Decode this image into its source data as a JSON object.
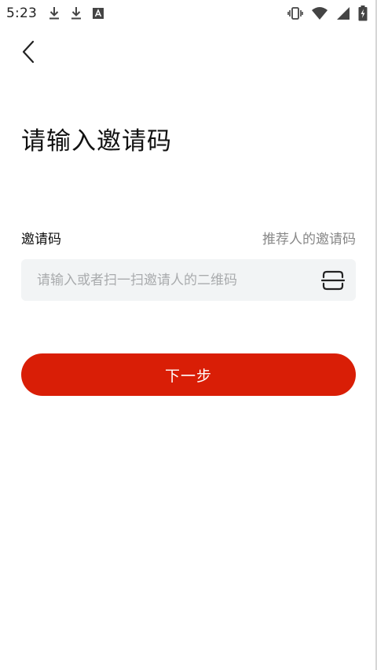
{
  "status_bar": {
    "time": "5:23",
    "icons_left": [
      "download-icon",
      "download-icon",
      "font-icon"
    ],
    "icons_right": [
      "vibrate-icon",
      "wifi-icon",
      "signal-icon",
      "battery-icon"
    ]
  },
  "header": {
    "back_icon": "back-arrow-icon"
  },
  "page": {
    "title": "请输入邀请码"
  },
  "form": {
    "label": "邀请码",
    "hint": "推荐人的邀请码",
    "input_value": "",
    "input_placeholder": "请输入或者扫一扫邀请人的二维码",
    "scan_icon": "scan-icon"
  },
  "actions": {
    "next_label": "下一步"
  },
  "colors": {
    "accent": "#d91e06",
    "input_bg": "#f2f4f5",
    "hint_text": "#888888",
    "placeholder_text": "#a9abad"
  }
}
